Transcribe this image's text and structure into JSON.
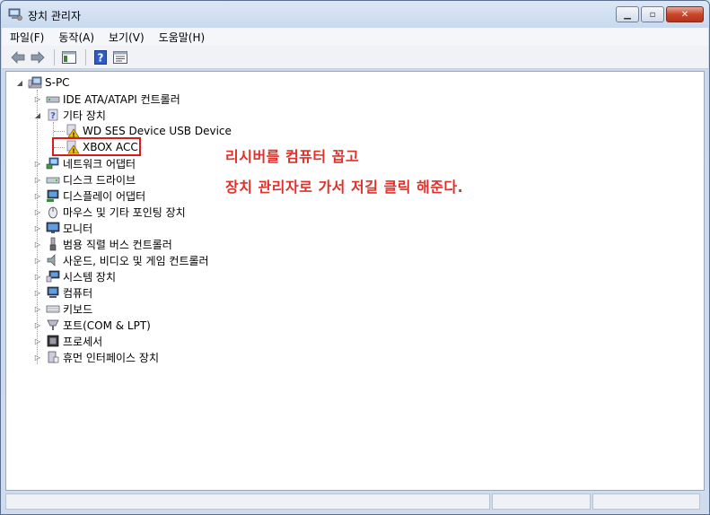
{
  "window": {
    "title": "장치 관리자"
  },
  "menu": [
    "파일(F)",
    "동작(A)",
    "보기(V)",
    "도움말(H)"
  ],
  "tree": {
    "root": "S-PC",
    "categories": [
      {
        "label": "IDE ATA/ATAPI 컨트롤러",
        "icon": "ide-controller-icon"
      },
      {
        "label": "기타 장치",
        "icon": "unknown-device-icon",
        "expanded": true,
        "children": [
          {
            "label": "WD SES Device USB Device",
            "icon": "warning-device-icon"
          },
          {
            "label": "XBOX ACC",
            "icon": "warning-device-icon",
            "highlighted": true
          }
        ]
      },
      {
        "label": "네트워크 어댑터",
        "icon": "network-adapter-icon"
      },
      {
        "label": "디스크 드라이브",
        "icon": "disk-drive-icon"
      },
      {
        "label": "디스플레이 어댑터",
        "icon": "display-adapter-icon"
      },
      {
        "label": "마우스 및 기타 포인팅 장치",
        "icon": "mouse-icon"
      },
      {
        "label": "모니터",
        "icon": "monitor-icon"
      },
      {
        "label": "범용 직렬 버스 컨트롤러",
        "icon": "usb-icon"
      },
      {
        "label": "사운드, 비디오 및 게임 컨트롤러",
        "icon": "sound-icon"
      },
      {
        "label": "시스템 장치",
        "icon": "system-device-icon"
      },
      {
        "label": "컴퓨터",
        "icon": "computer-icon"
      },
      {
        "label": "키보드",
        "icon": "keyboard-icon"
      },
      {
        "label": "포트(COM & LPT)",
        "icon": "port-icon"
      },
      {
        "label": "프로세서",
        "icon": "processor-icon"
      },
      {
        "label": "휴먼 인터페이스 장치",
        "icon": "hid-icon"
      }
    ]
  },
  "annotation": {
    "line1": "리시버를 컴퓨터 꼽고",
    "line2": "장치 관리자로 가서 저길 클릭 해준다."
  },
  "colors": {
    "annotation": "#e0302a",
    "highlight": "#d81b1b"
  }
}
